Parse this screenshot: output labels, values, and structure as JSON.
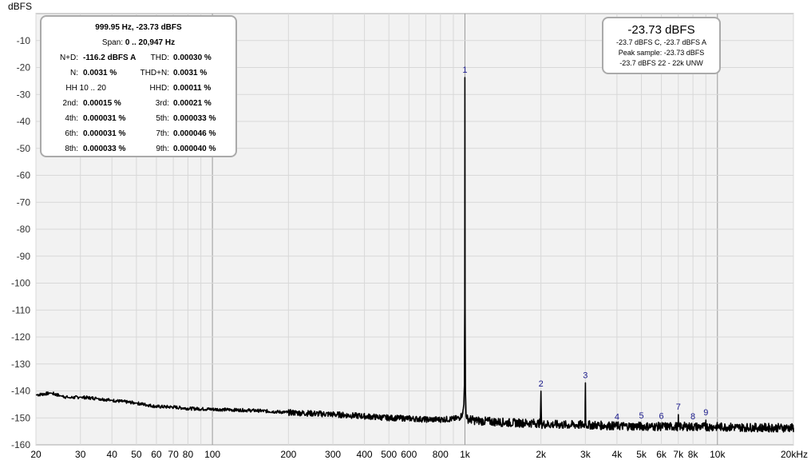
{
  "chart_data": {
    "type": "line",
    "ylabel": "dBFS",
    "xlabel_unit": "",
    "x_scale": "log",
    "xlim": [
      20,
      20000
    ],
    "ylim": [
      -160,
      0
    ],
    "grid": true,
    "y_ticks": [
      -10,
      -20,
      -30,
      -40,
      -50,
      -60,
      -70,
      -80,
      -90,
      -100,
      -110,
      -120,
      -130,
      -140,
      -150,
      -160
    ],
    "x_ticks": [
      {
        "v": 20,
        "label": "20"
      },
      {
        "v": 30,
        "label": "30"
      },
      {
        "v": 40,
        "label": "40"
      },
      {
        "v": 50,
        "label": "50"
      },
      {
        "v": 60,
        "label": "60"
      },
      {
        "v": 70,
        "label": "70"
      },
      {
        "v": 80,
        "label": "80"
      },
      {
        "v": 100,
        "label": "100"
      },
      {
        "v": 200,
        "label": "200"
      },
      {
        "v": 300,
        "label": "300"
      },
      {
        "v": 400,
        "label": "400"
      },
      {
        "v": 500,
        "label": "500"
      },
      {
        "v": 600,
        "label": "600"
      },
      {
        "v": 800,
        "label": "800"
      },
      {
        "v": 1000,
        "label": "1k"
      },
      {
        "v": 2000,
        "label": "2k"
      },
      {
        "v": 3000,
        "label": "3k"
      },
      {
        "v": 4000,
        "label": "4k"
      },
      {
        "v": 5000,
        "label": "5k"
      },
      {
        "v": 6000,
        "label": "6k"
      },
      {
        "v": 7000,
        "label": "7k"
      },
      {
        "v": 8000,
        "label": "8k"
      },
      {
        "v": 10000,
        "label": "10k"
      },
      {
        "v": 20000,
        "label": "20kHz"
      }
    ],
    "series": [
      {
        "x": [
          20,
          23,
          25,
          27,
          30,
          35,
          40,
          50,
          60,
          70,
          80,
          100,
          150,
          200,
          300,
          400,
          500,
          600,
          700,
          800,
          900,
          950,
          980,
          990,
          995,
          998,
          999.95,
          1002,
          1005,
          1010,
          1020,
          1050,
          1100,
          1500,
          1990,
          1995,
          2000,
          2005,
          2010,
          2500,
          2990,
          2995,
          3000,
          3005,
          3010,
          3500,
          4000,
          4500,
          5000,
          5500,
          6000,
          6500,
          6990,
          7000,
          7010,
          7500,
          8000,
          8500,
          8990,
          9000,
          9010,
          10000,
          12000,
          15000,
          20000
        ],
        "y": [
          -141.5,
          -140.8,
          -141.8,
          -142.5,
          -142.3,
          -142.8,
          -143.5,
          -144.5,
          -145.8,
          -146.0,
          -146.5,
          -146.8,
          -147.3,
          -148.0,
          -148.7,
          -149.4,
          -150.0,
          -150.2,
          -150.6,
          -150.6,
          -150.4,
          -150.0,
          -148.5,
          -145,
          -138,
          -110,
          -23.73,
          -110,
          -140,
          -148,
          -150.3,
          -150.6,
          -151.0,
          -151.8,
          -152,
          -146,
          -140.1,
          -146,
          -152.3,
          -152.6,
          -152.6,
          -145,
          -137.0,
          -145,
          -152.6,
          -152.8,
          -153.0,
          -153.1,
          -153.1,
          -153.2,
          -153.2,
          -153.2,
          -153.2,
          -148.8,
          -153.2,
          -153.2,
          -153.3,
          -153.3,
          -153.3,
          -150.8,
          -153.3,
          -153.3,
          -153.5,
          -153.6,
          -153.7
        ]
      }
    ],
    "harmonics": [
      {
        "label": "1",
        "x": 999.95,
        "y": -23.73
      },
      {
        "label": "2",
        "x": 2000,
        "y": -140.1
      },
      {
        "label": "3",
        "x": 3000,
        "y": -137.0
      },
      {
        "label": "4",
        "x": 4000,
        "y": -152.4
      },
      {
        "label": "5",
        "x": 5000,
        "y": -152.0
      },
      {
        "label": "6",
        "x": 6000,
        "y": -152.2
      },
      {
        "label": "7",
        "x": 7000,
        "y": -148.8
      },
      {
        "label": "8",
        "x": 8000,
        "y": -152.3
      },
      {
        "label": "9",
        "x": 9000,
        "y": -150.8
      }
    ]
  },
  "info": {
    "freq_line": "999.95 Hz, -23.73 dBFS",
    "span_label": "Span:",
    "span_value": "0 .. 20,947 Hz",
    "nd_label": "N+D:",
    "nd_value": "-116.2 dBFS A",
    "thd_label": "THD:",
    "thd_value": "0.00030 %",
    "n_label": "N:",
    "n_value": "0.0031 %",
    "thdn_label": "THD+N:",
    "thdn_value": "0.0031 %",
    "hh_label": "HH 10 .. 20",
    "hhd_label": "HHD:",
    "hhd_value": "0.00011 %",
    "h2_label": "2nd:",
    "h2_value": "0.00015 %",
    "h3_label": "3rd:",
    "h3_value": "0.00021 %",
    "h4_label": "4th:",
    "h4_value": "0.000031 %",
    "h5_label": "5th:",
    "h5_value": "0.000033 %",
    "h6_label": "6th:",
    "h6_value": "0.000031 %",
    "h7_label": "7th:",
    "h7_value": "0.000046 %",
    "h8_label": "8th:",
    "h8_value": "0.000033 %",
    "h9_label": "9th:",
    "h9_value": "0.000040 %"
  },
  "peak": {
    "title": "-23.73 dBFS",
    "line1": "-23.7 dBFS C, -23.7 dBFS A",
    "line2": "Peak sample: -23.73 dBFS",
    "line3": "-23.7 dBFS 22 - 22k UNW"
  },
  "colors": {
    "plot_bg": "#f2f2f2",
    "grid": "#d8d8d8",
    "decade_grid": "#9a9a9a",
    "trace": "#000000",
    "harmonic_label": "#1a1a8c"
  }
}
